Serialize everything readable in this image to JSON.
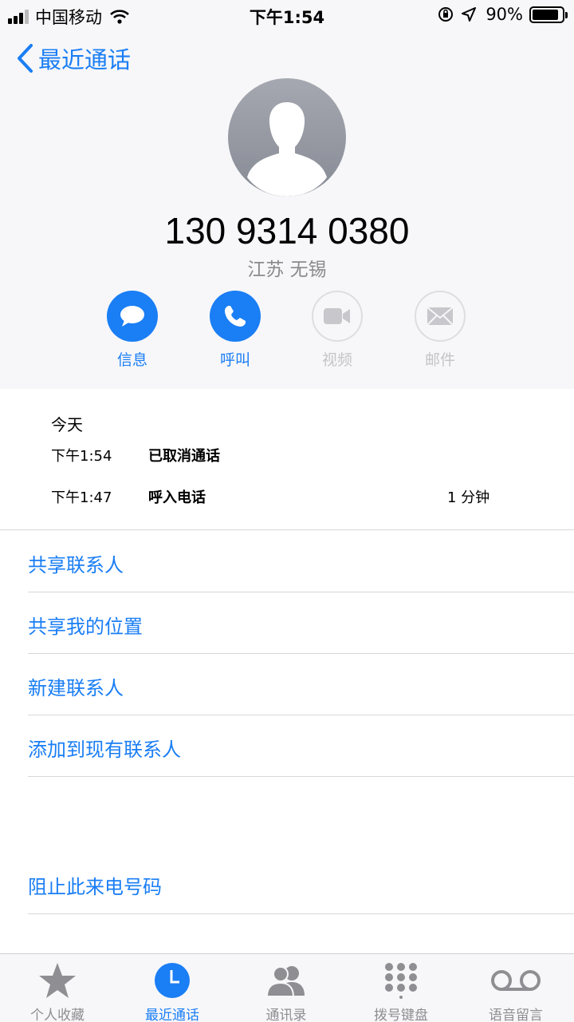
{
  "status_bar": {
    "carrier": "中国移动",
    "time": "下午1:54",
    "battery": "90%"
  },
  "nav": {
    "back_label": "最近通话"
  },
  "contact": {
    "number": "130 9314 0380",
    "location": "江苏 无锡"
  },
  "actions": {
    "message": "信息",
    "call": "呼叫",
    "video": "视频",
    "mail": "邮件"
  },
  "history": {
    "day": "今天",
    "calls": [
      {
        "time": "下午1:54",
        "desc": "已取消通话",
        "duration": ""
      },
      {
        "time": "下午1:47",
        "desc": "呼入电话",
        "duration": "1 分钟"
      }
    ]
  },
  "options": {
    "share_contact": "共享联系人",
    "share_location": "共享我的位置",
    "new_contact": "新建联系人",
    "add_existing": "添加到现有联系人",
    "block": "阻止此来电号码"
  },
  "tabs": {
    "favorites": "个人收藏",
    "recents": "最近通话",
    "contacts": "通讯录",
    "keypad": "拨号键盘",
    "voicemail": "语音留言"
  },
  "colors": {
    "accent": "#1a7ef5",
    "inactive": "#8e8e93"
  }
}
